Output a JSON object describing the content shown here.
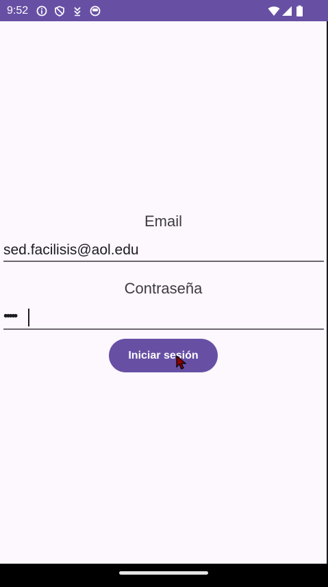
{
  "status_bar": {
    "time": "9:52",
    "left_icons": [
      "info-icon",
      "shield-icon",
      "download-icon",
      "circle-status-icon"
    ],
    "right_icons": [
      "wifi-icon",
      "cell-signal-icon",
      "battery-icon"
    ],
    "background_color": "#6750a4"
  },
  "login_form": {
    "email_label": "Email",
    "email_value": "sed.facilisis@aol.edu",
    "password_label": "Contraseña",
    "password_value": "•••••",
    "submit_label": "Iniciar sesión",
    "accent_color": "#6750a4"
  }
}
